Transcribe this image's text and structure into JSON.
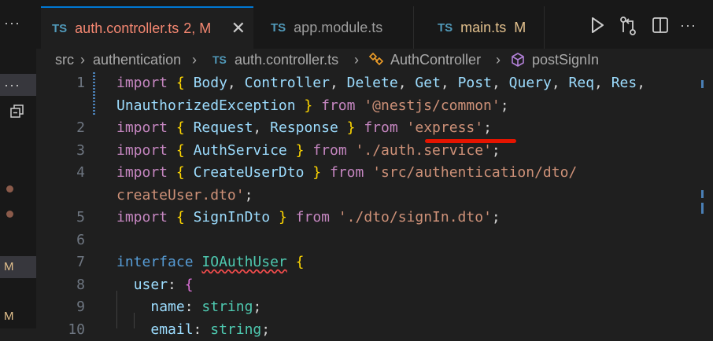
{
  "tabs": [
    {
      "lang": "TS",
      "name": "auth.controller.ts",
      "badge": "2, M",
      "active": true
    },
    {
      "lang": "TS",
      "name": "app.module.ts",
      "badge": ""
    },
    {
      "lang": "TS",
      "name": "main.ts",
      "badge": "M"
    }
  ],
  "activity": {
    "more_label": "···",
    "explorer_more_label": "···",
    "modified_badge_1": "M",
    "modified_badge_2": "M"
  },
  "breadcrumb": {
    "items": [
      "src",
      "authentication",
      "auth.controller.ts",
      "AuthController",
      "postSignIn"
    ],
    "file_lang": "TS"
  },
  "editor": {
    "lines": [
      {
        "num": "1",
        "tokens": [
          [
            "kw",
            "import"
          ],
          [
            "pl",
            " "
          ],
          [
            "br",
            "{"
          ],
          [
            "pl",
            " "
          ],
          [
            "id",
            "Body"
          ],
          [
            "pl",
            ", "
          ],
          [
            "id",
            "Controller"
          ],
          [
            "pl",
            ", "
          ],
          [
            "id",
            "Delete"
          ],
          [
            "pl",
            ", "
          ],
          [
            "id",
            "Get"
          ],
          [
            "pl",
            ", "
          ],
          [
            "id",
            "Post"
          ],
          [
            "pl",
            ", "
          ],
          [
            "id",
            "Query"
          ],
          [
            "pl",
            ", "
          ],
          [
            "id",
            "Req"
          ],
          [
            "pl",
            ", "
          ],
          [
            "id",
            "Res"
          ],
          [
            "pl",
            ","
          ]
        ]
      },
      {
        "num": "",
        "tokens": [
          [
            "id",
            "UnauthorizedException"
          ],
          [
            "pl",
            " "
          ],
          [
            "br",
            "}"
          ],
          [
            "pl",
            " "
          ],
          [
            "kw",
            "from"
          ],
          [
            "pl",
            " "
          ],
          [
            "str",
            "'@nestjs/common'"
          ],
          [
            "pl",
            ";"
          ]
        ]
      },
      {
        "num": "2",
        "tokens": [
          [
            "kw",
            "import"
          ],
          [
            "pl",
            " "
          ],
          [
            "br",
            "{"
          ],
          [
            "pl",
            " "
          ],
          [
            "id",
            "Request"
          ],
          [
            "pl",
            ", "
          ],
          [
            "id",
            "Response"
          ],
          [
            "pl",
            " "
          ],
          [
            "br",
            "}"
          ],
          [
            "pl",
            " "
          ],
          [
            "kw",
            "from"
          ],
          [
            "pl",
            " "
          ],
          [
            "str",
            "'express'"
          ],
          [
            "pl",
            ";"
          ]
        ]
      },
      {
        "num": "3",
        "tokens": [
          [
            "kw",
            "import"
          ],
          [
            "pl",
            " "
          ],
          [
            "br",
            "{"
          ],
          [
            "pl",
            " "
          ],
          [
            "id",
            "AuthService"
          ],
          [
            "pl",
            " "
          ],
          [
            "br",
            "}"
          ],
          [
            "pl",
            " "
          ],
          [
            "kw",
            "from"
          ],
          [
            "pl",
            " "
          ],
          [
            "str",
            "'./auth.service'"
          ],
          [
            "pl",
            ";"
          ]
        ]
      },
      {
        "num": "4",
        "tokens": [
          [
            "kw",
            "import"
          ],
          [
            "pl",
            " "
          ],
          [
            "br",
            "{"
          ],
          [
            "pl",
            " "
          ],
          [
            "id",
            "CreateUserDto"
          ],
          [
            "pl",
            " "
          ],
          [
            "br",
            "}"
          ],
          [
            "pl",
            " "
          ],
          [
            "kw",
            "from"
          ],
          [
            "pl",
            " "
          ],
          [
            "str",
            "'src/authentication/dto/"
          ]
        ]
      },
      {
        "num": "",
        "tokens": [
          [
            "str",
            "createUser.dto'"
          ],
          [
            "pl",
            ";"
          ]
        ]
      },
      {
        "num": "5",
        "tokens": [
          [
            "kw",
            "import"
          ],
          [
            "pl",
            " "
          ],
          [
            "br",
            "{"
          ],
          [
            "pl",
            " "
          ],
          [
            "id",
            "SignInDto"
          ],
          [
            "pl",
            " "
          ],
          [
            "br",
            "}"
          ],
          [
            "pl",
            " "
          ],
          [
            "kw",
            "from"
          ],
          [
            "pl",
            " "
          ],
          [
            "str",
            "'./dto/signIn.dto'"
          ],
          [
            "pl",
            ";"
          ]
        ]
      },
      {
        "num": "6",
        "tokens": []
      },
      {
        "num": "7",
        "tokens": [
          [
            "kw2",
            "interface"
          ],
          [
            "pl",
            " "
          ],
          [
            "tysq",
            "IOAuthUser"
          ],
          [
            "pl",
            " "
          ],
          [
            "br",
            "{"
          ]
        ]
      },
      {
        "num": "8",
        "tokens": [
          [
            "pl",
            "  "
          ],
          [
            "id",
            "user"
          ],
          [
            "pl",
            ": "
          ],
          [
            "br2",
            "{"
          ]
        ]
      },
      {
        "num": "9",
        "tokens": [
          [
            "pl",
            "    "
          ],
          [
            "id",
            "name"
          ],
          [
            "pl",
            ": "
          ],
          [
            "ty",
            "string"
          ],
          [
            "pl",
            ";"
          ]
        ]
      },
      {
        "num": "10",
        "tokens": [
          [
            "pl",
            "    "
          ],
          [
            "id",
            "email"
          ],
          [
            "pl",
            ": "
          ],
          [
            "ty",
            "string"
          ],
          [
            "pl",
            ";"
          ]
        ]
      }
    ]
  }
}
